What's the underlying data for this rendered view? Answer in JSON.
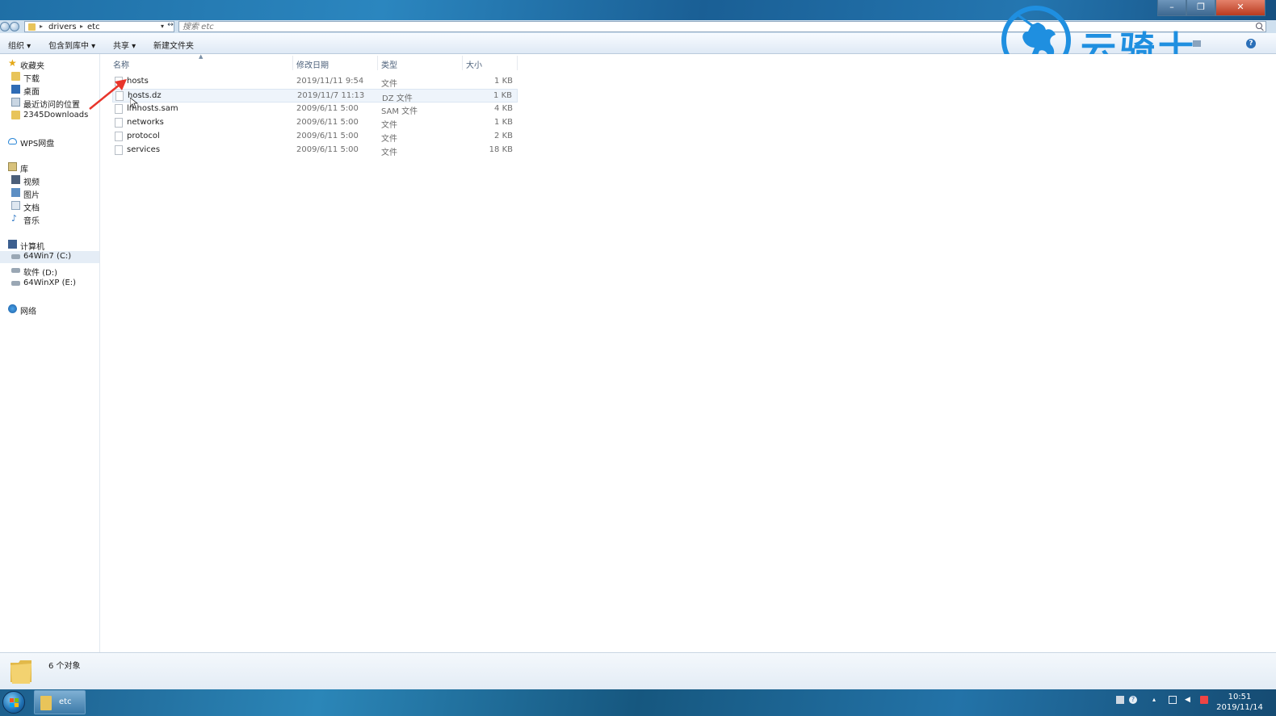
{
  "window": {
    "breadcrumbs": [
      "drivers",
      "etc"
    ],
    "search_placeholder": "搜索 etc",
    "min_glyph": "–",
    "max_glyph": "❐",
    "close_glyph": "✕",
    "refresh_glyph": "↔"
  },
  "toolbar": {
    "organize": "组织 ▾",
    "include": "包含到库中 ▾",
    "share": "共享 ▾",
    "new_folder": "新建文件夹",
    "help": "?"
  },
  "watermark": {
    "text": "云骑士",
    "color": "#1f8fe0"
  },
  "sidebar": {
    "favorites": {
      "label": "收藏夹",
      "items": [
        "下载",
        "桌面",
        "最近访问的位置",
        "2345Downloads"
      ]
    },
    "wps": "WPS网盘",
    "libraries": {
      "label": "库",
      "items": [
        "视频",
        "图片",
        "文档",
        "音乐"
      ]
    },
    "computer": {
      "label": "计算机",
      "items": [
        "64Win7  (C:)",
        "软件 (D:)",
        "64WinXP  (E:)"
      ]
    },
    "network": "网络"
  },
  "columns": {
    "name": "名称",
    "date": "修改日期",
    "type": "类型",
    "size": "大小"
  },
  "files": [
    {
      "name": "hosts",
      "date": "2019/11/11 9:54",
      "type": "文件",
      "size": "1 KB"
    },
    {
      "name": "hosts.dz",
      "date": "2019/11/7 11:13",
      "type": "DZ 文件",
      "size": "1 KB"
    },
    {
      "name": "lmhosts.sam",
      "date": "2009/6/11 5:00",
      "type": "SAM 文件",
      "size": "4 KB"
    },
    {
      "name": "networks",
      "date": "2009/6/11 5:00",
      "type": "文件",
      "size": "1 KB"
    },
    {
      "name": "protocol",
      "date": "2009/6/11 5:00",
      "type": "文件",
      "size": "2 KB"
    },
    {
      "name": "services",
      "date": "2009/6/11 5:00",
      "type": "文件",
      "size": "18 KB"
    }
  ],
  "status": {
    "count": "6 个对象"
  },
  "taskbar": {
    "task_label": "etc",
    "time": "10:51",
    "date": "2019/11/14"
  },
  "colors": {
    "accent": "#2b86bf",
    "annotation_arrow": "#e8352b",
    "hover_row": "#eef4fb"
  }
}
